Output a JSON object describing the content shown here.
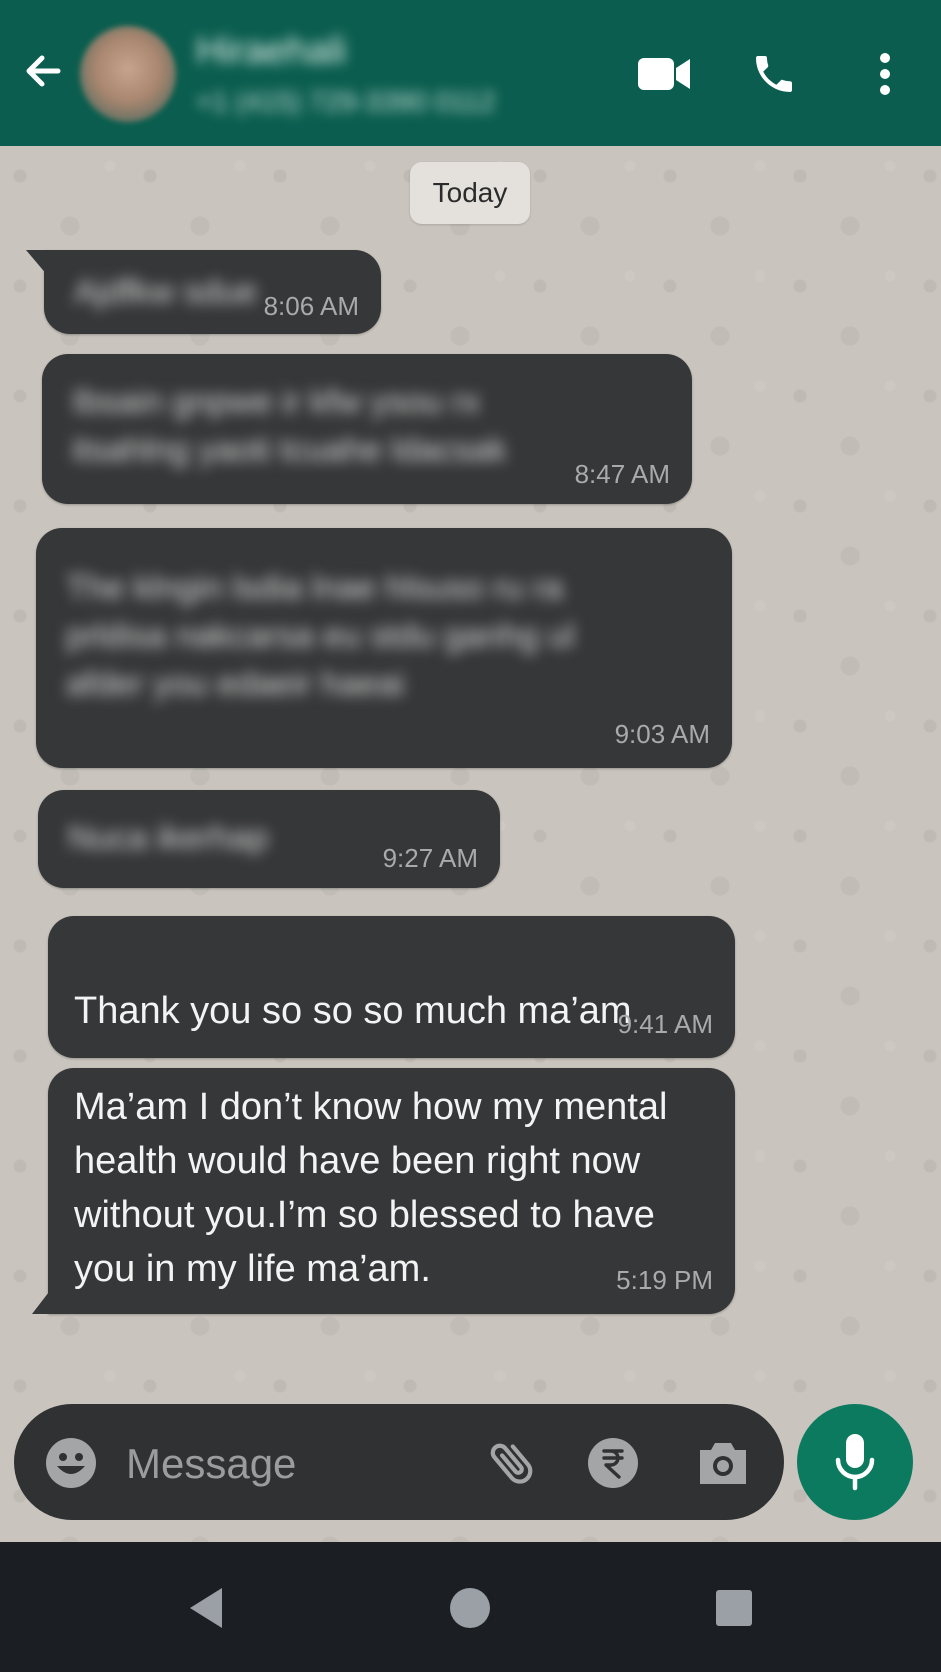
{
  "header": {
    "contact_name": "Hiraehali",
    "contact_subtitle": "+1 (415) 729-3390 0112",
    "colors": {
      "background": "#0b5e4f",
      "icon": "#ffffff"
    },
    "icons": [
      "arrow-left-icon",
      "video-call-icon",
      "phone-icon",
      "more-vertical-icon"
    ]
  },
  "chat": {
    "date_chip": "Today",
    "messages": [
      {
        "text": "Ajdfkw sdue",
        "time": "8:06 AM",
        "blurred": true
      },
      {
        "text": "Ibsain gnpwe ir kfw ysou rx\nitsahlng yaoti tcuahe ldacsak",
        "time": "8:47 AM",
        "blurred": true
      },
      {
        "text": "The klngin lsdia lnae hlsuso ru ra\nprldisa nakcarsa eu stdu ganhg ul\nafder you edaeir haeai",
        "time": "9:03 AM",
        "blurred": true
      },
      {
        "text": "Nuca ikerhap",
        "time": "9:27 AM",
        "blurred": true
      },
      {
        "text": "Thank you so so so much ma’am",
        "time": "9:41 AM",
        "blurred": false,
        "emoji": "heart-icon"
      },
      {
        "text": "Ma’am I don’t know how my mental\nhealth would have been right now\nwithout you.I’m so blessed to have\nyou in my life ma’am.",
        "time": "5:19 PM",
        "blurred": false
      }
    ],
    "colors": {
      "bubble": "#363738",
      "text": "#f3f3f3",
      "time": "#a9aaab",
      "chip": "#e4e1dd"
    }
  },
  "composer": {
    "placeholder": "Message",
    "icons": [
      "emoji-icon",
      "paperclip-icon",
      "rupee-icon",
      "camera-icon",
      "microphone-icon"
    ],
    "colors": {
      "bar": "#2f3132",
      "mic_button": "#0b7a5e"
    }
  },
  "nav_bar": {
    "icons": [
      "nav-back-icon",
      "nav-home-icon",
      "nav-recents-icon"
    ]
  }
}
